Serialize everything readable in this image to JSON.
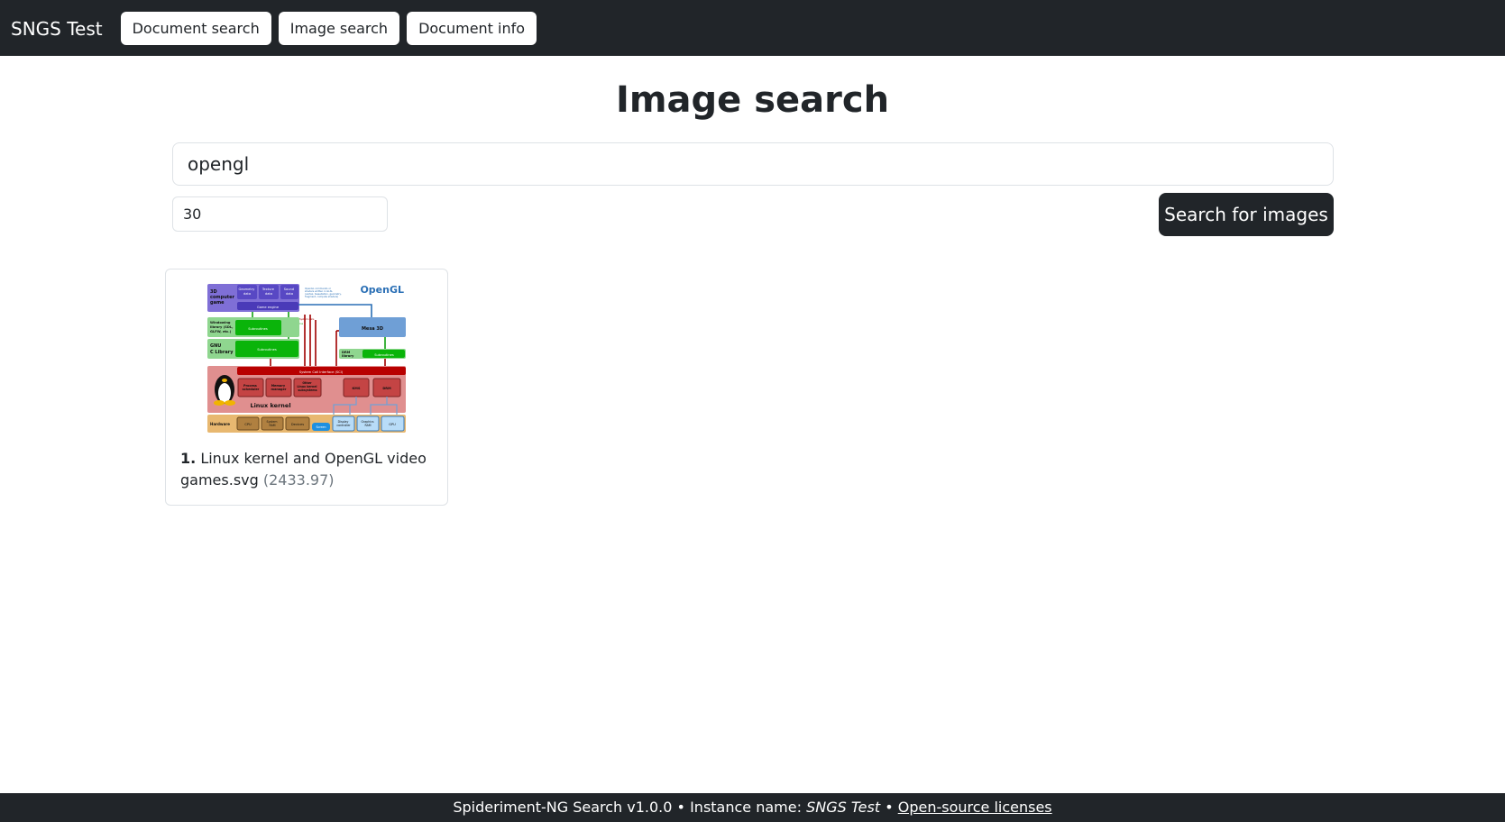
{
  "navbar": {
    "brand": "SNGS Test",
    "buttons": [
      {
        "label": "Document search"
      },
      {
        "label": "Image search"
      },
      {
        "label": "Document info"
      }
    ]
  },
  "main": {
    "title": "Image search",
    "query_value": "opengl",
    "limit_value": "30",
    "search_button": "Search for images"
  },
  "results": [
    {
      "index": "1.",
      "name": "Linux kernel and OpenGL video games.svg",
      "score": "(2433.97)",
      "thumbnail": {
        "logo": "OpenGL",
        "labels": {
          "game": [
            "3D",
            "computer",
            "game"
          ],
          "geometry": [
            "Geometry",
            "data"
          ],
          "texture": [
            "Texture",
            "data"
          ],
          "sound": [
            "Sound",
            "data"
          ],
          "engine": "Game engine",
          "windowing": [
            "Windowing",
            "library (SDL,",
            "GLFW, etc.)"
          ],
          "subroutines": "Subroutines",
          "glibc": [
            "GNU",
            "C Library"
          ],
          "mesa": "Mesa 3D",
          "drm_lib": [
            "DRM",
            "library"
          ],
          "sci": "System Call Interface (SCI)",
          "scheduler": [
            "Process",
            "scheduler"
          ],
          "memory": [
            "Memory",
            "manager"
          ],
          "other": [
            "Other",
            "Linux kernel",
            "subsystems"
          ],
          "kms": "KMS",
          "drm": "DRM",
          "kernel": "Linux kernel",
          "hardware": "Hardware",
          "cpu": "CPU",
          "ram": [
            "System",
            "RAM"
          ],
          "devices": "Devices",
          "screen": "Screen",
          "display": [
            "Display",
            "controller"
          ],
          "graphics_ram": [
            "Graphics",
            "RAM"
          ],
          "gpu": "GPU",
          "opengl_note": [
            "OpenGL commands or",
            "shaders written in GLSL",
            "(vertex, tessellation, geometry,",
            "fragment, compute shaders)"
          ],
          "syscalls": "System calls",
          "subroutine_calls": [
            "Subroutine",
            "calls"
          ]
        }
      }
    }
  ],
  "footer": {
    "product": "Spideriment-NG Search v1.0.0",
    "sep": "•",
    "instance_label": "Instance name:",
    "instance_name": "SNGS Test",
    "licenses_link": "Open-source licenses"
  }
}
